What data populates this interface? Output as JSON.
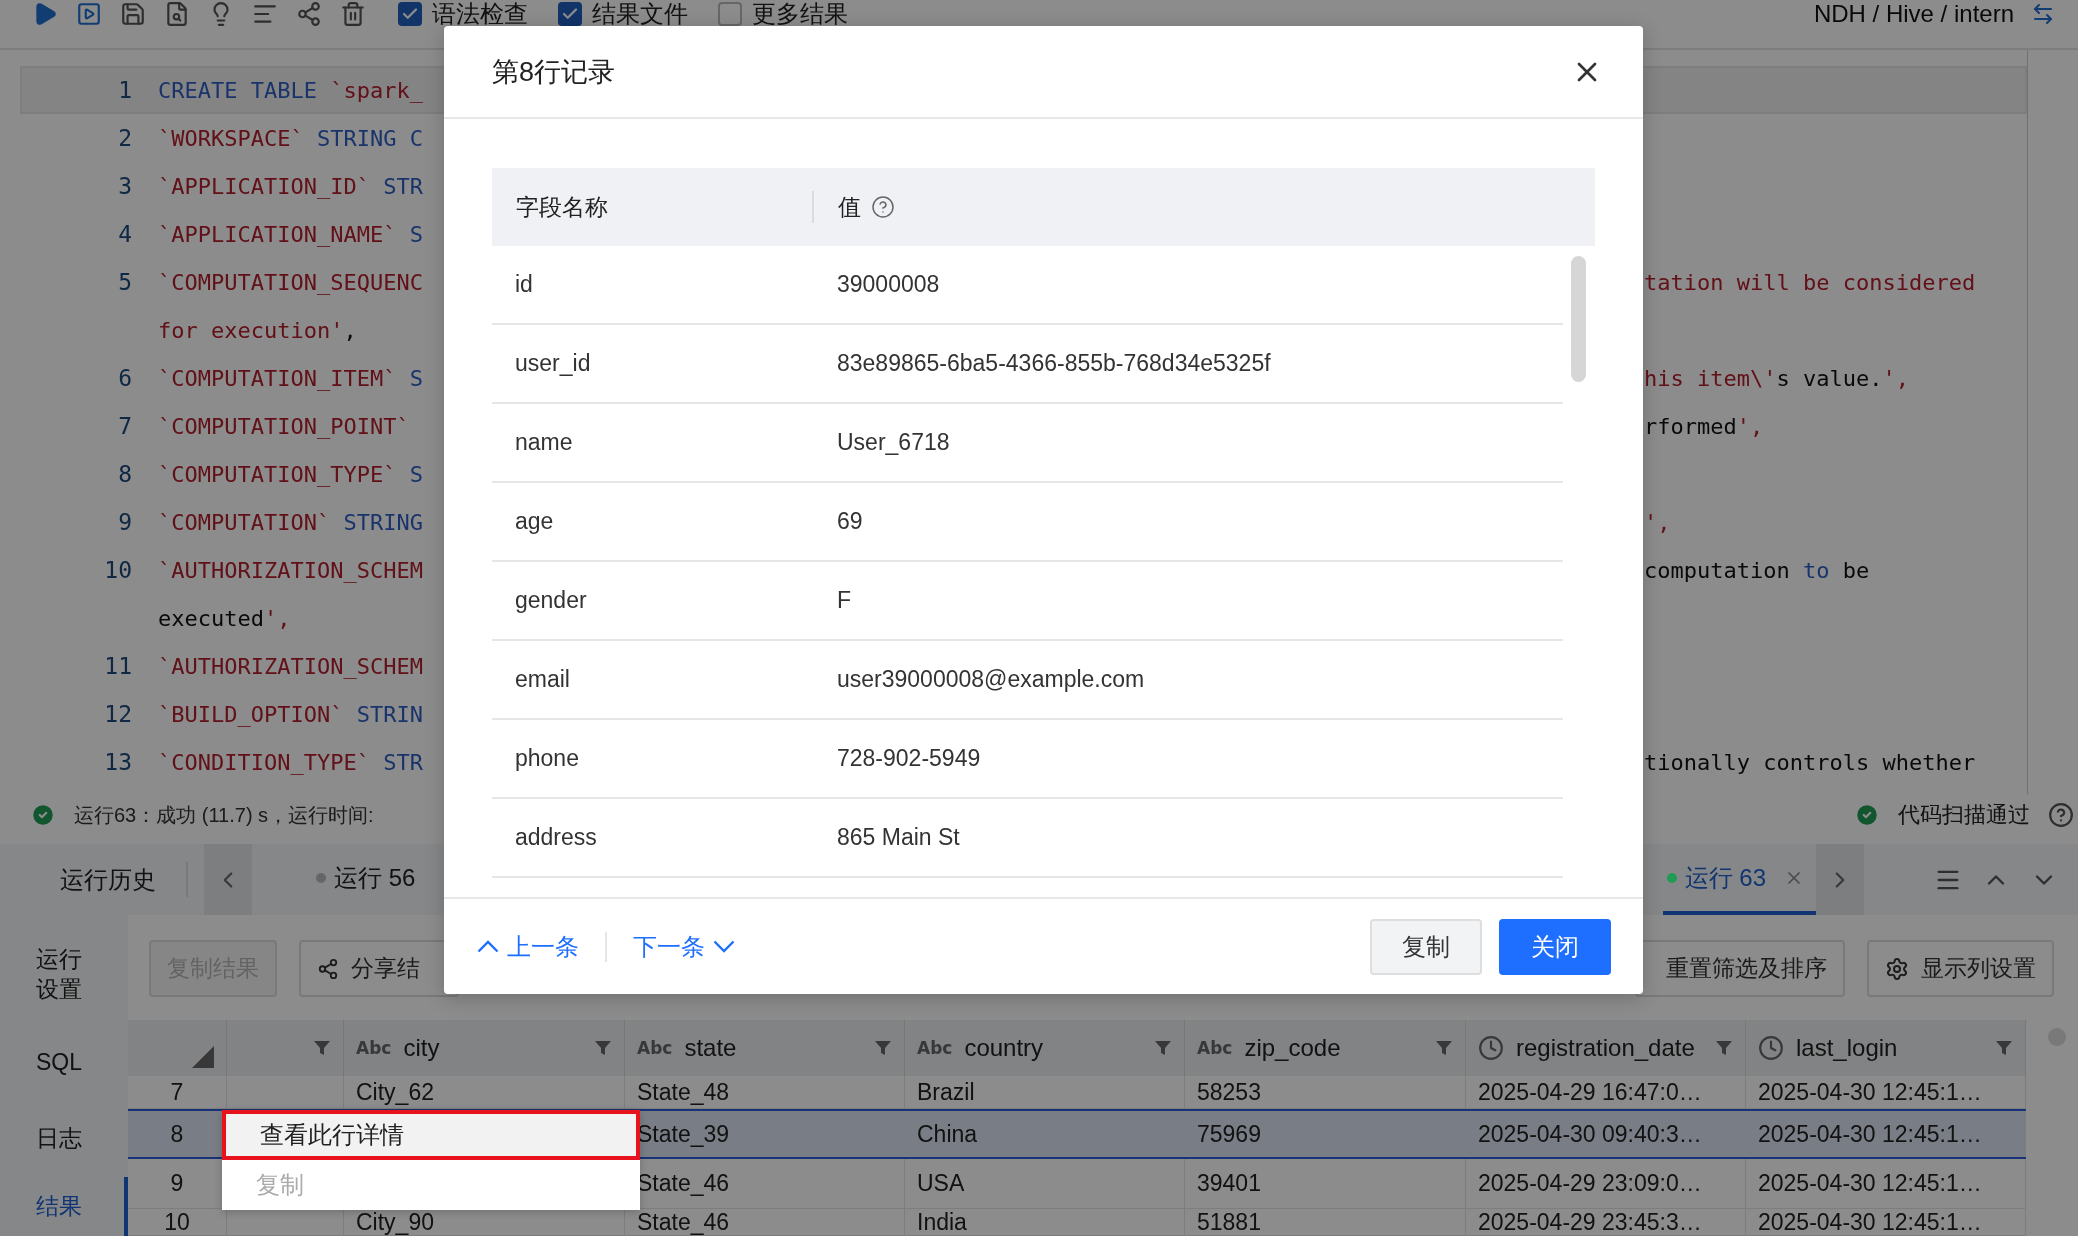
{
  "toolbar": {
    "checkboxes": [
      {
        "label": "语法检查",
        "checked": true
      },
      {
        "label": "结果文件",
        "checked": true
      },
      {
        "label": "更多结果",
        "checked": false
      }
    ],
    "breadcrumb": "NDH / Hive / intern"
  },
  "editor": {
    "lines": [
      {
        "number": "1",
        "current": true,
        "left": [
          {
            "text": "CREATE TABLE ",
            "kind": "keyword"
          },
          {
            "text": "`spark_",
            "kind": "ident"
          }
        ]
      },
      {
        "number": "2",
        "current": false,
        "left": [
          {
            "text": "`WORKSPACE`",
            "kind": "ident"
          },
          {
            "text": " STRING C",
            "kind": "keyword"
          }
        ]
      },
      {
        "number": "3",
        "current": false,
        "left": [
          {
            "text": "`APPLICATION_ID`",
            "kind": "ident"
          },
          {
            "text": " STR",
            "kind": "keyword"
          }
        ]
      },
      {
        "number": "4",
        "current": false,
        "left": [
          {
            "text": "`APPLICATION_NAME`",
            "kind": "ident"
          },
          {
            "text": " S",
            "kind": "keyword"
          }
        ]
      },
      {
        "number": "5",
        "current": false,
        "left": [
          {
            "text": "`COMPUTATION_SEQUENC",
            "kind": "ident"
          }
        ],
        "right": [
          {
            "text": "tation will be considered",
            "kind": "string"
          }
        ]
      },
      {
        "current": false,
        "left": [
          {
            "text": "for execution'",
            "kind": "string"
          },
          {
            "text": ",",
            "kind": "plain"
          }
        ]
      },
      {
        "number": "6",
        "current": false,
        "left": [
          {
            "text": "`COMPUTATION_ITEM`",
            "kind": "ident"
          },
          {
            "text": " S",
            "kind": "keyword"
          }
        ],
        "right": [
          {
            "text": "his item\\'",
            "kind": "string"
          },
          {
            "text": "s value.",
            "kind": "plain"
          },
          {
            "text": "',",
            "kind": "string"
          }
        ]
      },
      {
        "number": "7",
        "current": false,
        "left": [
          {
            "text": "`COMPUTATION_POINT`",
            "kind": "ident"
          }
        ],
        "right": [
          {
            "text": "rformed",
            "kind": "plain"
          },
          {
            "text": "',",
            "kind": "string"
          }
        ]
      },
      {
        "number": "8",
        "current": false,
        "left": [
          {
            "text": "`COMPUTATION_TYPE`",
            "kind": "ident"
          },
          {
            "text": " S",
            "kind": "keyword"
          }
        ]
      },
      {
        "number": "9",
        "current": false,
        "left": [
          {
            "text": "`COMPUTATION`",
            "kind": "ident"
          },
          {
            "text": " STRING",
            "kind": "keyword"
          }
        ],
        "right": [
          {
            "text": "',",
            "kind": "string"
          }
        ]
      },
      {
        "number": "10",
        "current": false,
        "left": [
          {
            "text": "`AUTHORIZATION_SCHEM",
            "kind": "ident"
          }
        ],
        "right": [
          {
            "text": "computation ",
            "kind": "plain"
          },
          {
            "text": "to",
            "kind": "keyword"
          },
          {
            "text": " be",
            "kind": "plain"
          }
        ]
      },
      {
        "current": false,
        "left": [
          {
            "text": "executed",
            "kind": "plain"
          },
          {
            "text": "',",
            "kind": "string"
          }
        ]
      },
      {
        "number": "11",
        "current": false,
        "left": [
          {
            "text": "`AUTHORIZATION_SCHEM",
            "kind": "ident"
          }
        ]
      },
      {
        "number": "12",
        "current": false,
        "left": [
          {
            "text": "`BUILD_OPTION`",
            "kind": "ident"
          },
          {
            "text": " STRIN",
            "kind": "keyword"
          }
        ]
      },
      {
        "number": "13",
        "current": false,
        "left": [
          {
            "text": "`CONDITION_TYPE`",
            "kind": "ident"
          },
          {
            "text": " STR",
            "kind": "keyword"
          }
        ],
        "right": [
          {
            "text": "tionally controls whether",
            "kind": "plain"
          }
        ]
      }
    ]
  },
  "status": {
    "message": "运行63：成功 (11.7) s，运行时间:",
    "scan": "代码扫描通过"
  },
  "run_tabs": {
    "history": "运行历史",
    "tabs": [
      {
        "label": "运行 56",
        "selected": false,
        "color": "#666666"
      },
      {
        "label": "运行 63",
        "selected": true,
        "color": "#1f9d55"
      }
    ]
  },
  "side_nav": [
    {
      "label": "运行设置",
      "selected": false
    },
    {
      "label": "SQL",
      "selected": false
    },
    {
      "label": "日志",
      "selected": false
    },
    {
      "label": "结果",
      "selected": true
    }
  ],
  "results_toolbar": {
    "left": [
      {
        "label": "复制结果",
        "disabled": true,
        "kind": "plain"
      },
      {
        "label": "分享结",
        "disabled": false,
        "kind": "share"
      }
    ],
    "right": [
      {
        "label": "重置筛选及排序",
        "disabled": false,
        "kind": "plain"
      },
      {
        "label": "显示列设置",
        "disabled": false,
        "kind": "gear"
      }
    ]
  },
  "grid": {
    "columns": [
      {
        "kind": "blank"
      },
      {
        "kind": "text",
        "type_label": "Abc",
        "name": "city"
      },
      {
        "kind": "text",
        "type_label": "Abc",
        "name": "state"
      },
      {
        "kind": "text",
        "type_label": "Abc",
        "name": "country"
      },
      {
        "kind": "text",
        "type_label": "Abc",
        "name": "zip_code"
      },
      {
        "kind": "time",
        "name": "registration_date"
      },
      {
        "kind": "time",
        "name": "last_login"
      }
    ],
    "rows": [
      {
        "number": "7",
        "selected": false,
        "cells": [
          null,
          "City_62",
          "State_48",
          "Brazil",
          "58253",
          "2025-04-29 16:47:0…",
          "2025-04-30 12:45:1…"
        ]
      },
      {
        "number": "8",
        "selected": true,
        "cells": [
          null,
          null,
          "State_39",
          "China",
          "75969",
          "2025-04-30 09:40:3…",
          "2025-04-30 12:45:1…"
        ]
      },
      {
        "number": "9",
        "selected": false,
        "cells": [
          null,
          null,
          "State_46",
          "USA",
          "39401",
          "2025-04-29 23:09:0…",
          "2025-04-30 12:45:1…"
        ]
      },
      {
        "number": "10",
        "selected": false,
        "cells": [
          null,
          "City_90",
          "State_46",
          "India",
          "51881",
          "2025-04-29 23:45:3…",
          "2025-04-30 12:45:1…"
        ]
      }
    ]
  },
  "context_menu": {
    "items": [
      {
        "label": "查看此行详情",
        "highlighted": true,
        "disabled": false
      },
      {
        "label": "复制",
        "highlighted": false,
        "disabled": true
      }
    ]
  },
  "dialog": {
    "title": "第8行记录",
    "columns": [
      "字段名称",
      "值"
    ],
    "rows": [
      {
        "field": "id",
        "value": "39000008"
      },
      {
        "field": "user_id",
        "value": "83e89865-6ba5-4366-855b-768d34e5325f"
      },
      {
        "field": "name",
        "value": "User_6718"
      },
      {
        "field": "age",
        "value": "69"
      },
      {
        "field": "gender",
        "value": "F"
      },
      {
        "field": "email",
        "value": "user39000008@example.com"
      },
      {
        "field": "phone",
        "value": "728-902-5949"
      },
      {
        "field": "address",
        "value": "865 Main St"
      }
    ],
    "prev": "上一条",
    "next": "下一条",
    "buttons": [
      {
        "label": "复制",
        "kind": "secondary"
      },
      {
        "label": "关闭",
        "kind": "primary"
      }
    ]
  }
}
